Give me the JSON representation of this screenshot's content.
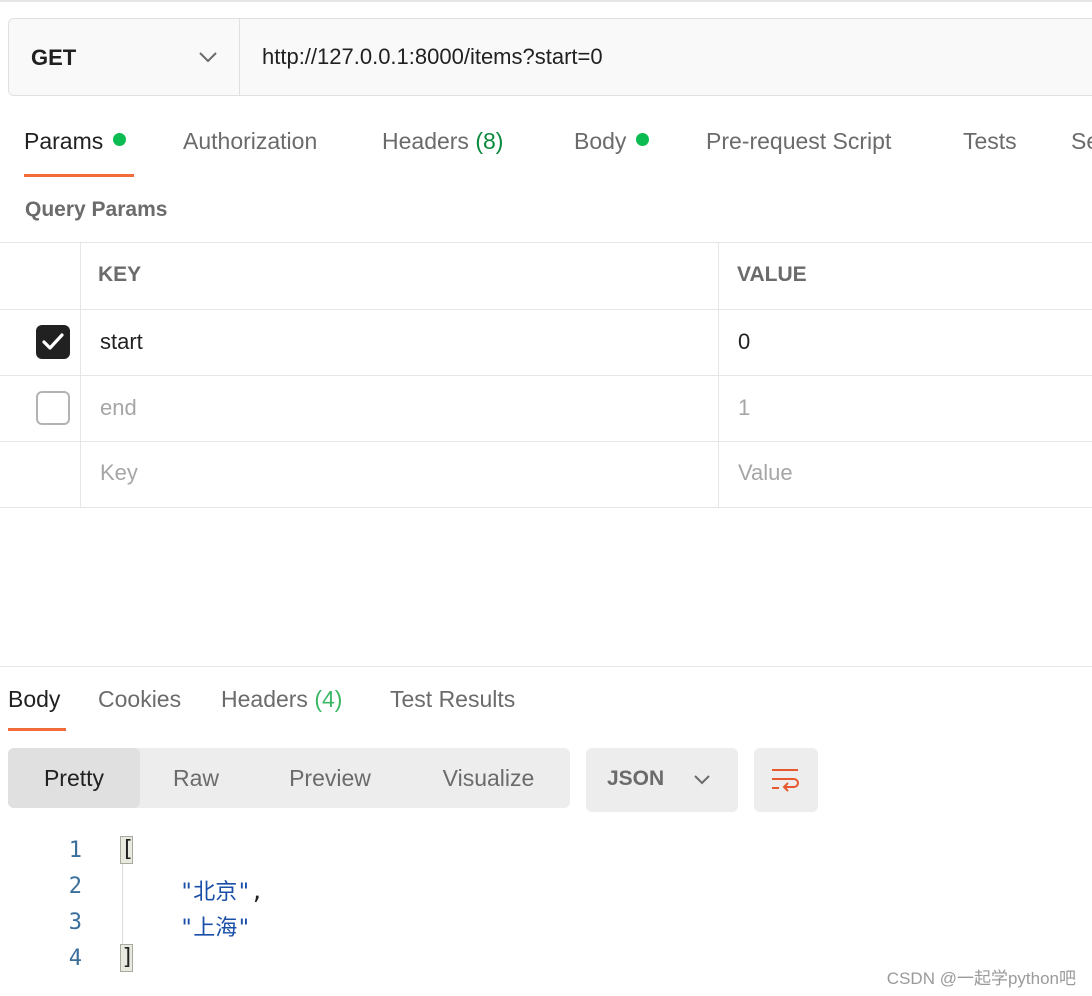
{
  "request": {
    "method": "GET",
    "url": "http://127.0.0.1:8000/items?start=0"
  },
  "request_tabs": [
    {
      "label": "Params",
      "dot": true
    },
    {
      "label": "Authorization"
    },
    {
      "label": "Headers",
      "count": "(8)"
    },
    {
      "label": "Body",
      "dot": true
    },
    {
      "label": "Pre-request Script"
    },
    {
      "label": "Tests"
    },
    {
      "label": "Se"
    }
  ],
  "query_params": {
    "title": "Query Params",
    "headers": {
      "key": "KEY",
      "value": "VALUE"
    },
    "rows": [
      {
        "checked": true,
        "key": "start",
        "value": "0"
      },
      {
        "checked": false,
        "key": "end",
        "value": "1"
      }
    ],
    "placeholder": {
      "key": "Key",
      "value": "Value"
    }
  },
  "response_tabs": [
    {
      "label": "Body"
    },
    {
      "label": "Cookies"
    },
    {
      "label": "Headers",
      "count": "(4)"
    },
    {
      "label": "Test Results"
    }
  ],
  "view_modes": [
    "Pretty",
    "Raw",
    "Preview",
    "Visualize"
  ],
  "format": "JSON",
  "code": {
    "line_numbers": [
      "1",
      "2",
      "3",
      "4"
    ],
    "open": "[",
    "items": [
      "\"北京\"",
      "\"上海\""
    ],
    "comma": ",",
    "close": "]"
  },
  "watermark": "CSDN @一起学python吧",
  "colors": {
    "accent": "#f26b3a",
    "dot": "#0cbb52",
    "count": "#0a8a3c",
    "string": "#1a4fa8"
  }
}
